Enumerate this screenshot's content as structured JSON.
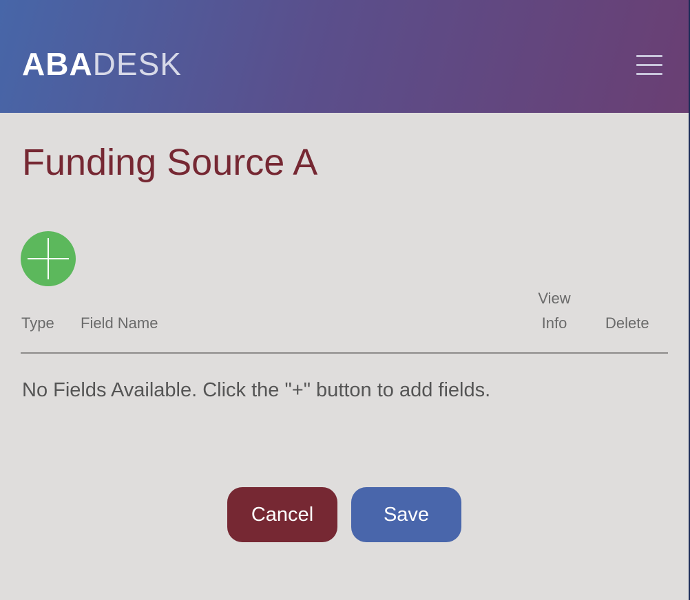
{
  "header": {
    "logo_bold": "ABA",
    "logo_light": "DESK",
    "menu_icon": "hamburger-menu-icon"
  },
  "colors": {
    "header_gradient_start": "#4766a8",
    "header_gradient_end": "#6a3f73",
    "title": "#762833",
    "background": "#dfdddc",
    "add_button": "#5cb85c",
    "cancel_button": "#762833",
    "save_button": "#4966ab"
  },
  "main": {
    "title": "Funding Source A",
    "add_icon": "plus-icon",
    "table": {
      "columns": {
        "type": "Type",
        "field_name": "Field Name",
        "view_info_line1": "View",
        "view_info_line2": "Info",
        "delete": "Delete"
      },
      "empty_message": "No Fields Available. Click the \"+\" button to add fields."
    }
  },
  "actions": {
    "cancel_label": "Cancel",
    "save_label": "Save"
  }
}
